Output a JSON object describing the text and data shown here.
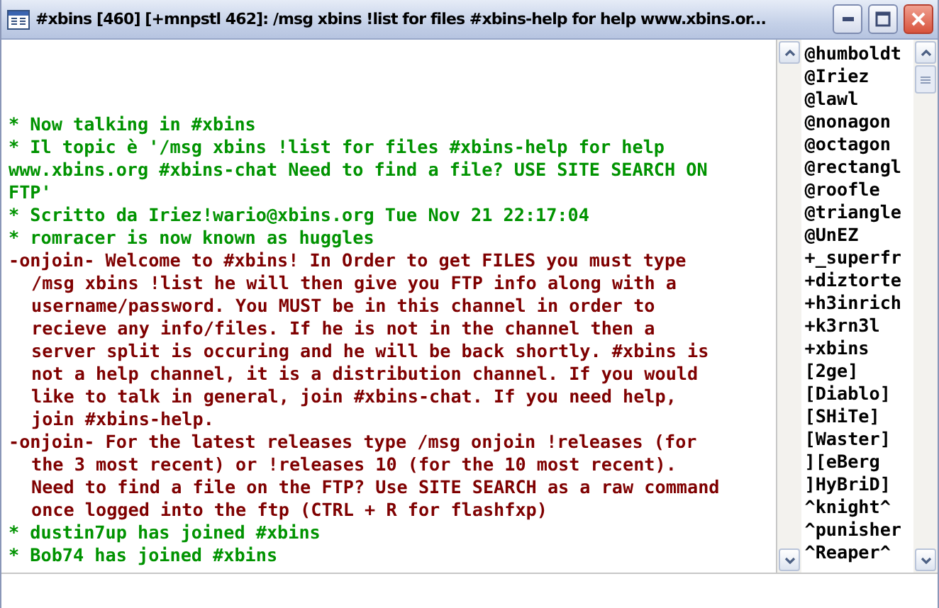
{
  "window": {
    "title": "#xbins [460] [+mnpstl 462]: /msg xbins !list for files #xbins-help for help www.xbins.or..."
  },
  "messages": [
    {
      "kind": "info",
      "lines": [
        "* Now talking in #xbins"
      ]
    },
    {
      "kind": "info",
      "lines": [
        "* Il topic è '/msg xbins !list for files #xbins-help for help",
        "www.xbins.org #xbins-chat Need to find a file? USE SITE SEARCH ON",
        "FTP'"
      ]
    },
    {
      "kind": "info",
      "lines": [
        "* Scritto da Iriez!wario@xbins.org Tue Nov 21 22:17:04"
      ]
    },
    {
      "kind": "info",
      "lines": [
        "* romracer is now known as huggles"
      ]
    },
    {
      "kind": "notice",
      "lines": [
        "-onjoin- Welcome to #xbins! In Order to get FILES you must type",
        "**/msg xbins !list** he will then give you FTP info along with a",
        "username/password. You MUST be in this channel in order to",
        "recieve any info/files. If he is not in the channel then a",
        "server split is occuring and he will be back shortly. #xbins is",
        "not a help channel, it is a distribution channel. If you would",
        "like to talk in general, join #xbins-chat. If you need help,",
        "join #xbins-help."
      ]
    },
    {
      "kind": "notice",
      "lines": [
        "-onjoin- For the latest releases type /msg onjoin !releases (for",
        "the 3 most recent) or !releases 10 (for the 10 most recent).",
        "Need to find a file on the FTP? Use SITE SEARCH as a raw command",
        "once logged into the ftp (CTRL + R for flashfxp)"
      ]
    },
    {
      "kind": "info",
      "lines": [
        "* dustin7up has joined #xbins"
      ]
    },
    {
      "kind": "info",
      "lines": [
        "* Bob74 has joined #xbins"
      ]
    }
  ],
  "nicks": [
    "@humboldt",
    "@Iriez",
    "@lawl",
    "@nonagon",
    "@octagon",
    "@rectangl",
    "@roofle",
    "@triangle",
    "@UnEZ",
    "+_superfr",
    "+diztorte",
    "+h3inrich",
    "+k3rn3l",
    "+xbins",
    "[2ge]",
    "[Diablo]",
    "[SHiTe]",
    "[Waster]",
    "][eBerg",
    "]HyBriD]",
    "^knight^",
    "^punisher",
    "^Reaper^"
  ]
}
